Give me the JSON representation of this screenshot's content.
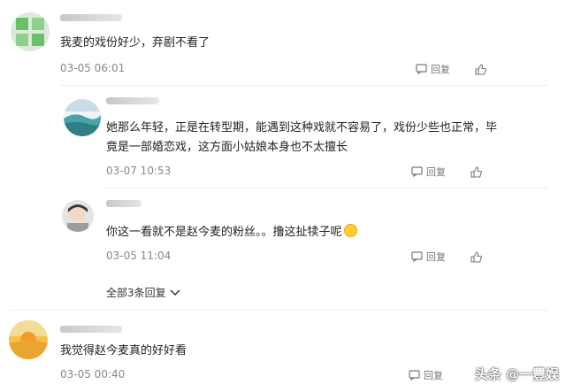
{
  "comments": [
    {
      "text": "我麦的戏份好少，弃剧不看了",
      "time": "03-05 06:01",
      "reply_label": "回复"
    },
    {
      "text_line1": "她那么年轻，正是在转型期，能遇到这种戏就不容易了，戏份少些也正常，毕",
      "text_line2": "竟是一部婚恋戏，这方面小姑娘本身也不太擅长",
      "time": "03-07 10:53",
      "reply_label": "回复"
    },
    {
      "text": "你这一看就不是赵今麦的粉丝。。撸这扯犊子呢",
      "time": "03-05 11:04",
      "reply_label": "回复"
    },
    {
      "text": "我觉得赵今麦真的好好看",
      "time": "03-05 00:40",
      "reply_label": "回复"
    }
  ],
  "replies_toggle": "全部3条回复",
  "watermark": "头条 @一豐娱",
  "icons": {
    "reply": "reply-icon",
    "like": "thumbs-up-icon",
    "chevron": "chevron-down-icon"
  }
}
